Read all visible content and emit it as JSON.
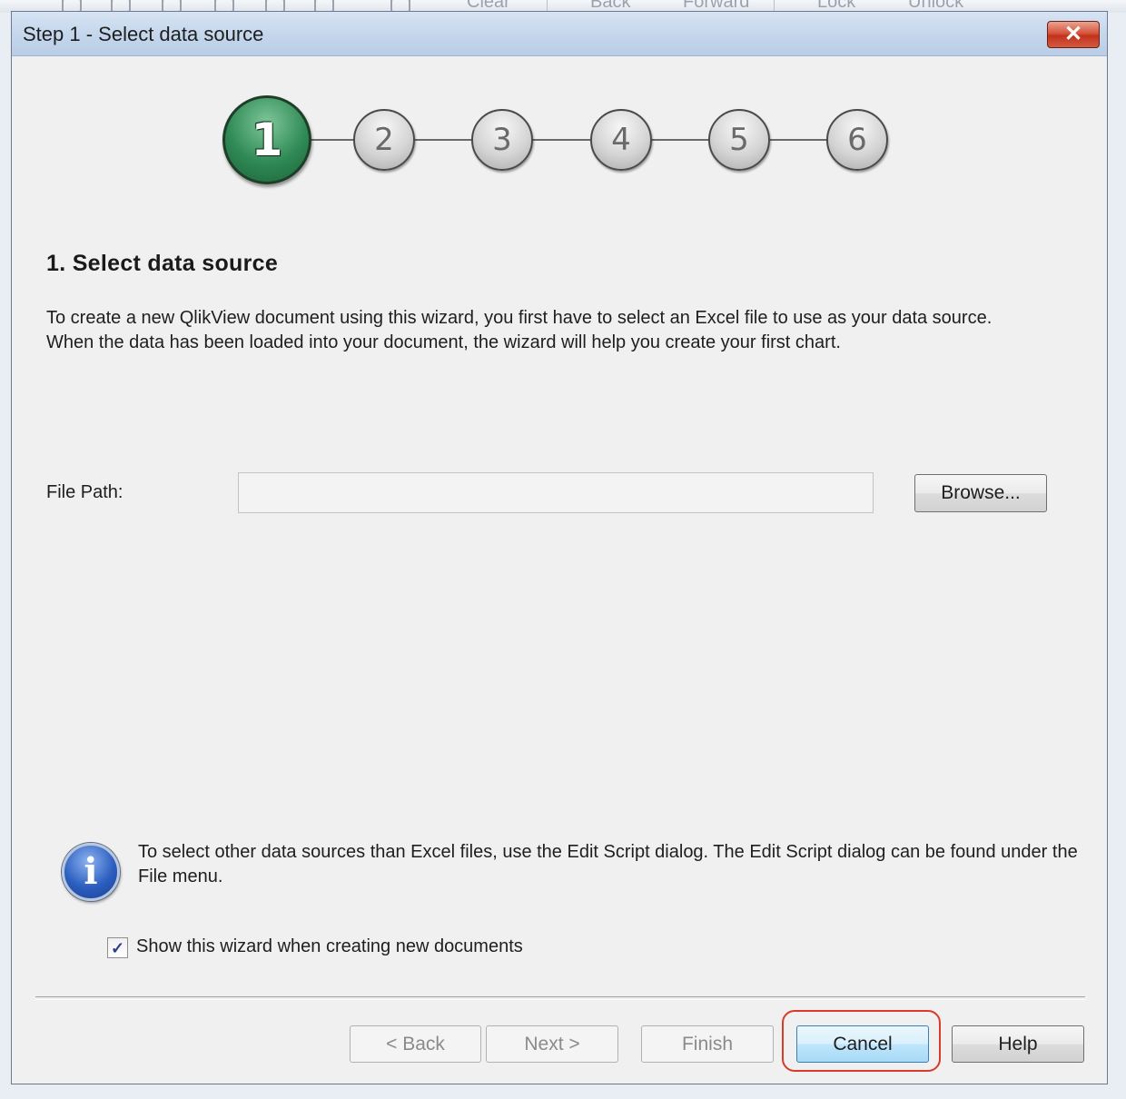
{
  "background_toolbar": {
    "items": [
      "Clear",
      "Back",
      "Forward",
      "Lock",
      "Unlock"
    ]
  },
  "window": {
    "title": "Step 1 - Select data source",
    "close_symbol": "✕"
  },
  "steps": {
    "current": 1,
    "labels": [
      "1",
      "2",
      "3",
      "4",
      "5",
      "6"
    ]
  },
  "content": {
    "heading": "1. Select data source",
    "description_line1": "To create a new QlikView document using this wizard, you first have to select an Excel file to use as your data source.",
    "description_line2": "When the data has been loaded into your document, the wizard will help you create your first chart."
  },
  "file_path": {
    "label": "File Path:",
    "value": "",
    "browse_label": "Browse..."
  },
  "info": {
    "icon": "info-icon",
    "text": "To select other data sources than Excel files, use the Edit Script dialog. The Edit Script dialog can be found under the File menu."
  },
  "show_wizard": {
    "checked": true,
    "label": "Show this wizard when creating new documents"
  },
  "buttons": {
    "back": "< Back",
    "next": "Next >",
    "finish": "Finish",
    "cancel": "Cancel",
    "help": "Help"
  },
  "colors": {
    "active_step": "#2f8a55",
    "highlight": "#d93a2b",
    "title_bar": "#c5d7ec"
  }
}
